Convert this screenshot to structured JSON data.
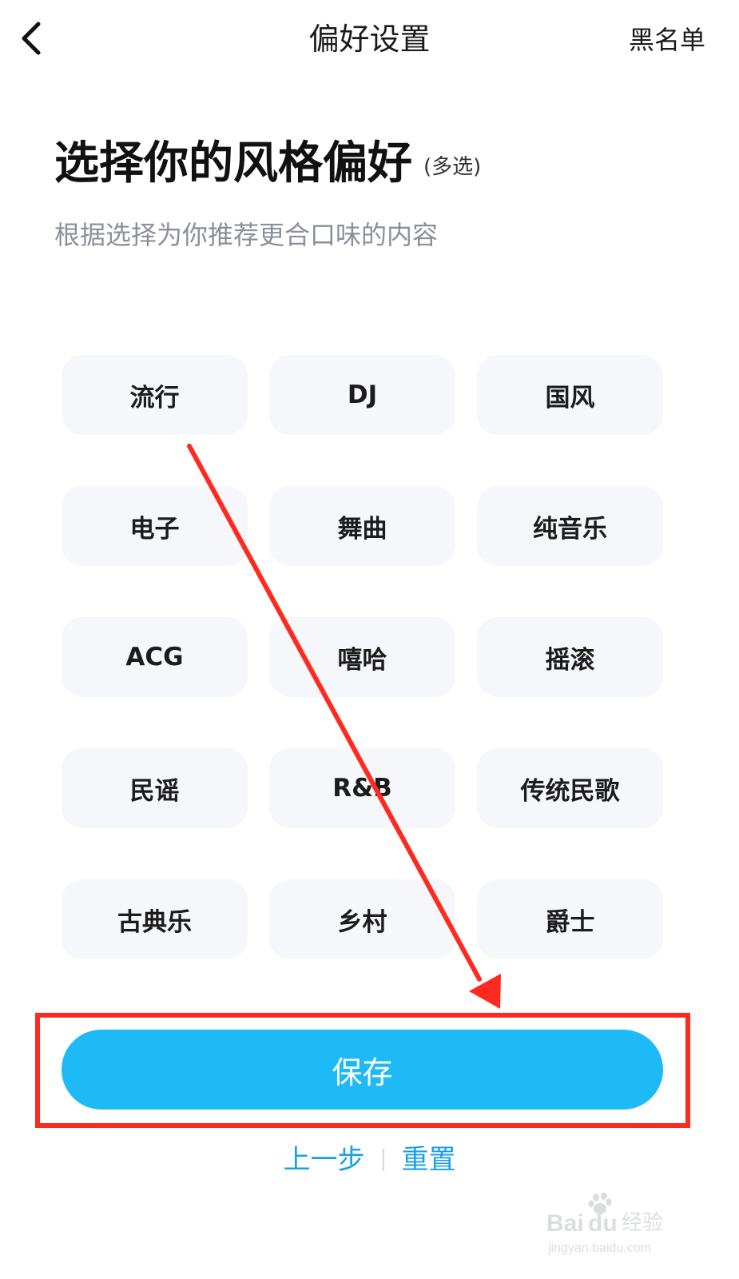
{
  "header": {
    "title": "偏好设置",
    "right_action": "黑名单",
    "back_icon": "back-arrow-icon"
  },
  "main": {
    "title": "选择你的风格偏好",
    "title_note": "(多选)",
    "subtitle": "根据选择为你推荐更合口味的内容",
    "genres": [
      "流行",
      "DJ",
      "国风",
      "电子",
      "舞曲",
      "纯音乐",
      "ACG",
      "嘻哈",
      "摇滚",
      "民谣",
      "R&B",
      "传统民歌",
      "古典乐",
      "乡村",
      "爵士"
    ]
  },
  "footer": {
    "save_label": "保存",
    "prev_label": "上一步",
    "reset_label": "重置"
  },
  "watermark": {
    "brand": "Baidu经验",
    "url": "jingyan.baidu.com"
  },
  "colors": {
    "accent": "#1dbaf5",
    "link": "#1aa0e8",
    "chip_bg": "#f6f7fa",
    "annotation": "#ff2a1f"
  }
}
